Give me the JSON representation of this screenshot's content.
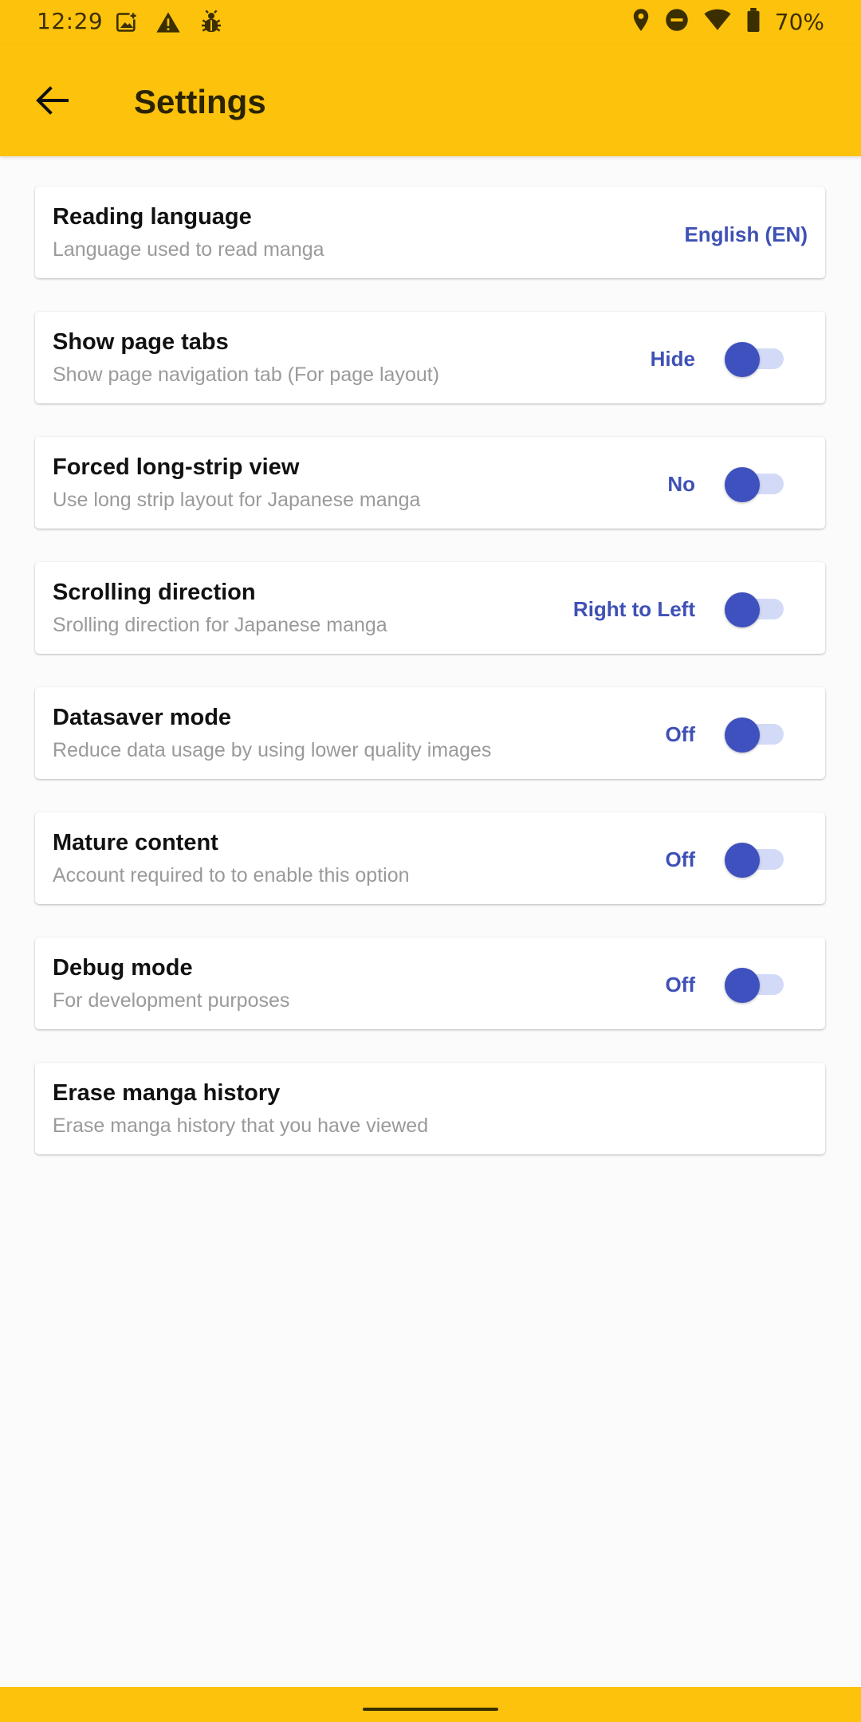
{
  "status_bar": {
    "time": "12:29",
    "battery_percent": "70%",
    "left_icons": [
      "image-notification-icon",
      "warning-icon",
      "bug-icon"
    ],
    "right_icons": [
      "location-icon",
      "do-not-disturb-icon",
      "wifi-icon",
      "battery-icon"
    ]
  },
  "app_bar": {
    "title": "Settings",
    "back_icon": "arrow-back-icon"
  },
  "settings": [
    {
      "title": "Reading language",
      "subtitle": "Language used to read manga",
      "value": "English (EN)",
      "has_toggle": false
    },
    {
      "title": "Show page tabs",
      "subtitle": "Show page navigation tab (For page layout)",
      "value": "Hide",
      "has_toggle": true
    },
    {
      "title": "Forced long-strip view",
      "subtitle": "Use long strip layout for Japanese manga",
      "value": "No",
      "has_toggle": true
    },
    {
      "title": "Scrolling direction",
      "subtitle": "Srolling direction for Japanese manga",
      "value": "Right to Left",
      "has_toggle": true
    },
    {
      "title": "Datasaver mode",
      "subtitle": "Reduce data usage by using lower quality images",
      "value": "Off",
      "has_toggle": true
    },
    {
      "title": "Mature content",
      "subtitle": "Account required to to enable this option",
      "value": "Off",
      "has_toggle": true
    },
    {
      "title": "Debug mode",
      "subtitle": "For development purposes",
      "value": "Off",
      "has_toggle": true
    },
    {
      "title": "Erase manga history",
      "subtitle": "Erase manga history that you have viewed",
      "value": "",
      "has_toggle": false
    }
  ],
  "colors": {
    "app_bar": "#FCC20C",
    "accent": "#3F51B5",
    "toggle_track": "#D2DAF7",
    "background": "#FCFBFC"
  }
}
